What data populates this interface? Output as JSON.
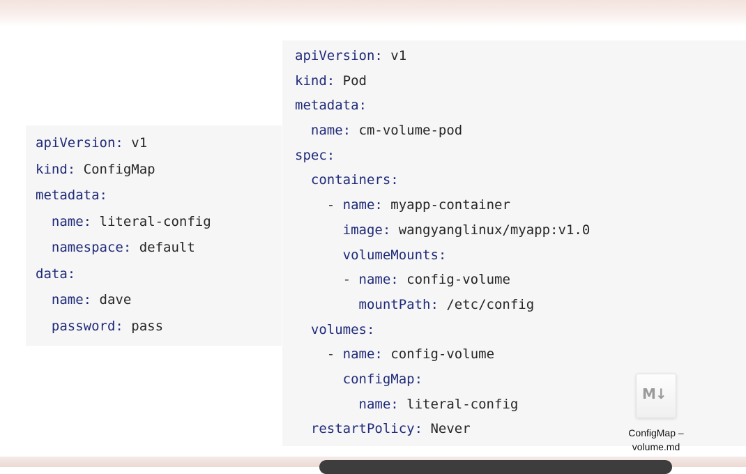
{
  "left_code": [
    {
      "indent": "",
      "dash": "",
      "key": "apiVersion:",
      "value": " v1"
    },
    {
      "indent": "",
      "dash": "",
      "key": "kind:",
      "value": " ConfigMap"
    },
    {
      "indent": "",
      "dash": "",
      "key": "metadata:",
      "value": ""
    },
    {
      "indent": "  ",
      "dash": "",
      "key": "name:",
      "value": " literal-config"
    },
    {
      "indent": "  ",
      "dash": "",
      "key": "namespace:",
      "value": " default"
    },
    {
      "indent": "",
      "dash": "",
      "key": "data:",
      "value": ""
    },
    {
      "indent": "  ",
      "dash": "",
      "key": "name:",
      "value": " dave"
    },
    {
      "indent": "  ",
      "dash": "",
      "key": "password:",
      "value": " pass"
    }
  ],
  "right_code": [
    {
      "indent": "",
      "dash": "",
      "key": "apiVersion:",
      "value": " v1"
    },
    {
      "indent": "",
      "dash": "",
      "key": "kind:",
      "value": " Pod"
    },
    {
      "indent": "",
      "dash": "",
      "key": "metadata:",
      "value": ""
    },
    {
      "indent": "  ",
      "dash": "",
      "key": "name:",
      "value": " cm-volume-pod"
    },
    {
      "indent": "",
      "dash": "",
      "key": "spec:",
      "value": ""
    },
    {
      "indent": "  ",
      "dash": "",
      "key": "containers:",
      "value": ""
    },
    {
      "indent": "    ",
      "dash": "- ",
      "key": "name:",
      "value": " myapp-container"
    },
    {
      "indent": "      ",
      "dash": "",
      "key": "image:",
      "value": " wangyanglinux/myapp:v1.0"
    },
    {
      "indent": "      ",
      "dash": "",
      "key": "volumeMounts:",
      "value": ""
    },
    {
      "indent": "      ",
      "dash": "- ",
      "key": "name:",
      "value": " config-volume"
    },
    {
      "indent": "        ",
      "dash": "",
      "key": "mountPath:",
      "value": " /etc/config"
    },
    {
      "indent": "  ",
      "dash": "",
      "key": "volumes:",
      "value": ""
    },
    {
      "indent": "    ",
      "dash": "- ",
      "key": "name:",
      "value": " config-volume"
    },
    {
      "indent": "      ",
      "dash": "",
      "key": "configMap:",
      "value": ""
    },
    {
      "indent": "        ",
      "dash": "",
      "key": "name:",
      "value": " literal-config"
    },
    {
      "indent": "  ",
      "dash": "",
      "key": "restartPolicy:",
      "value": " Never"
    }
  ],
  "file": {
    "icon": "markdown-file-icon",
    "glyph": "M↓",
    "label": "ConfigMap –\nvolume.md"
  },
  "colors": {
    "key": "#1f2a7a",
    "value": "#262626",
    "panel": "#f6f6f6"
  }
}
